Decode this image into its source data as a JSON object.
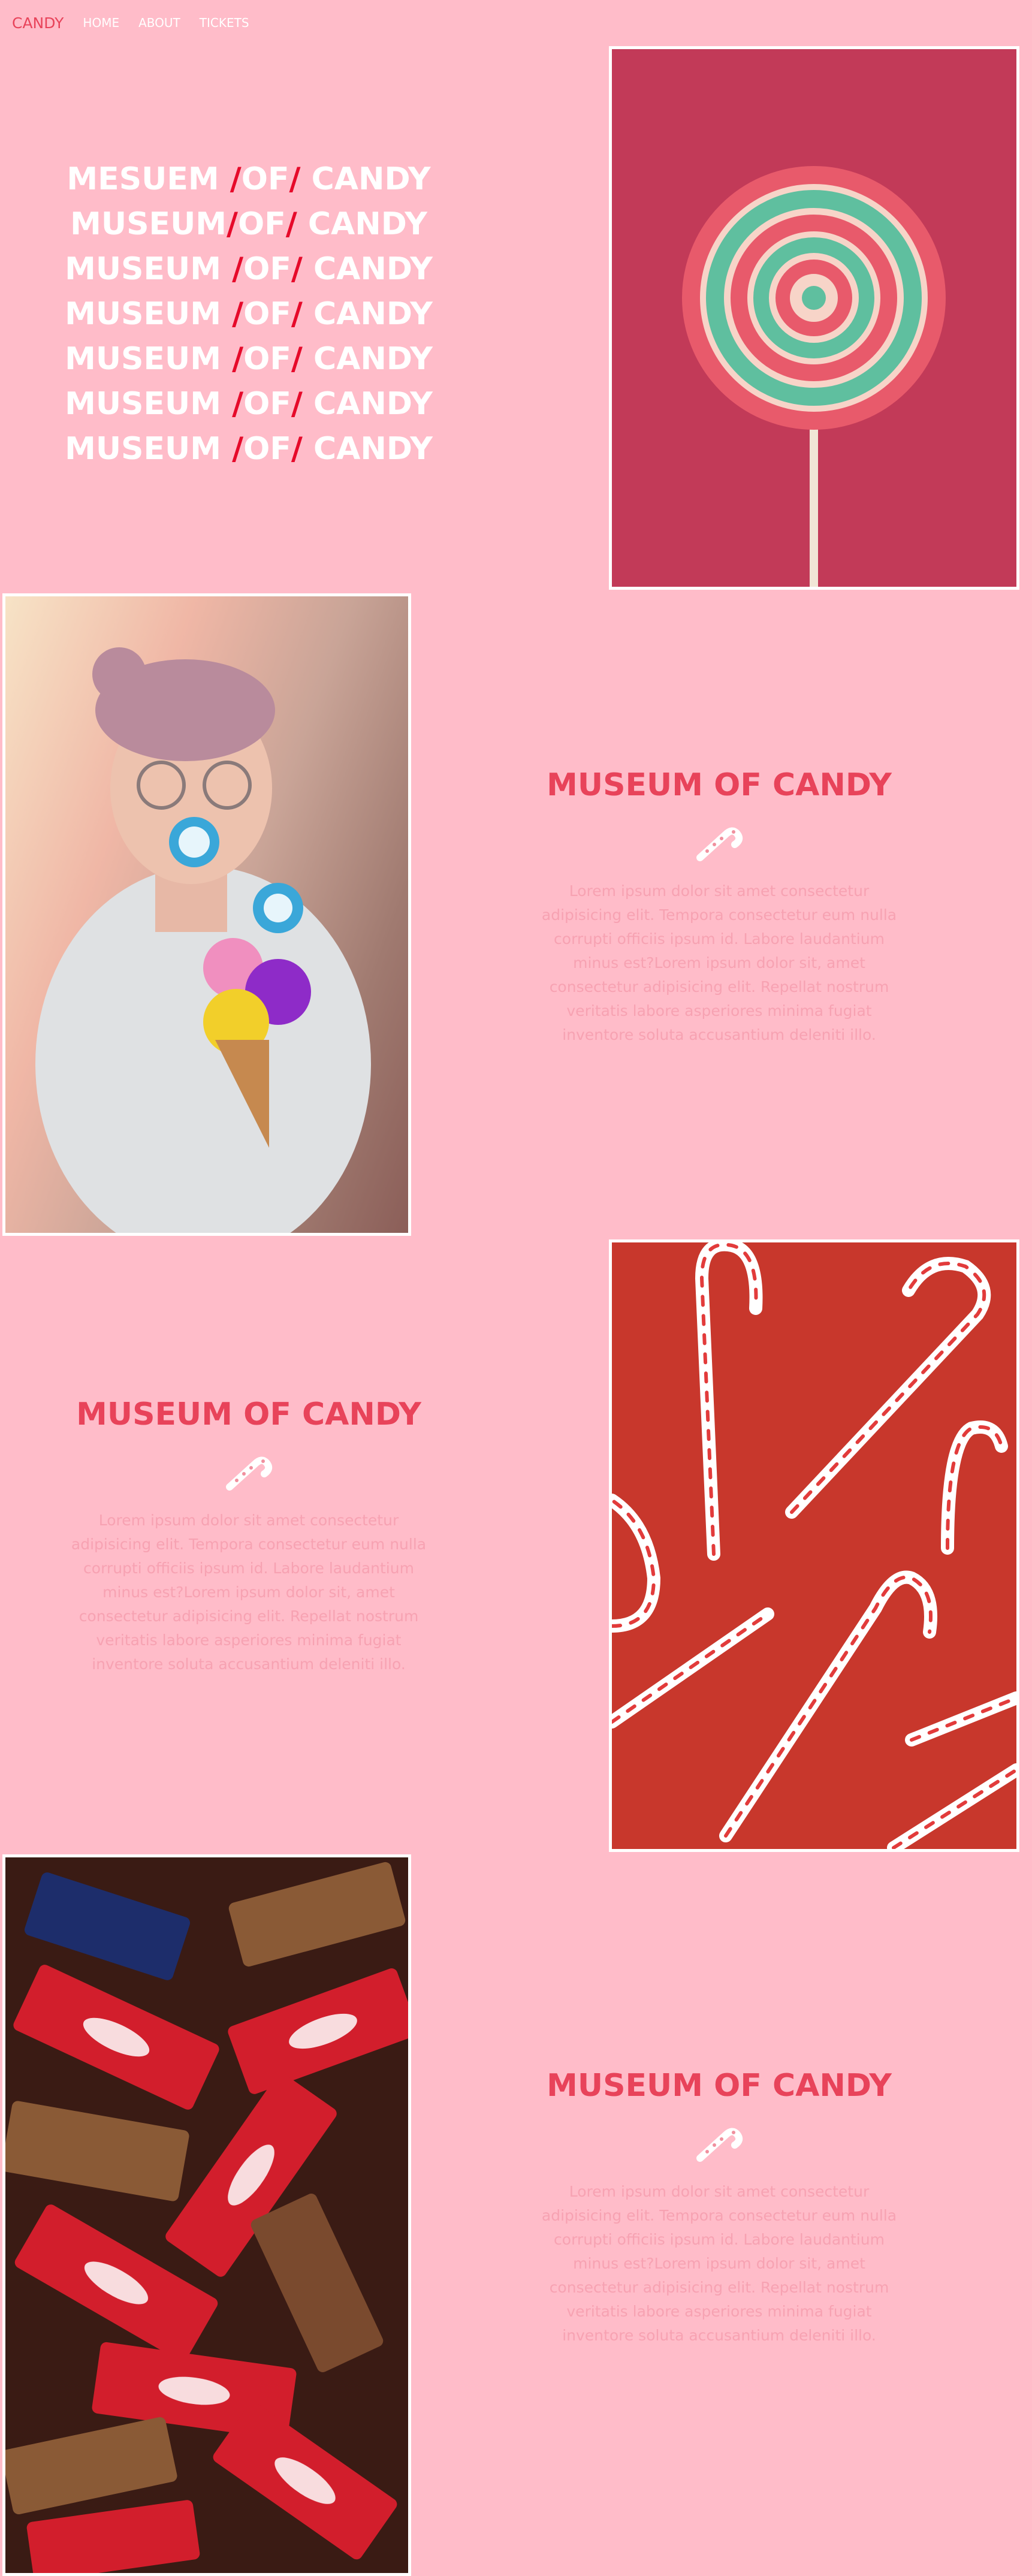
{
  "nav": {
    "brand": "CANDY",
    "links": [
      "HOME",
      "ABOUT",
      "TICKETS"
    ]
  },
  "hero": {
    "lines": [
      {
        "a": "MESUEM ",
        "slash1": "/",
        "b": "OF",
        "slash2": "/",
        "c": " CANDY"
      },
      {
        "a": "MUSEUM",
        "slash1": "/",
        "b": "OF",
        "slash2": "/",
        "c": " CANDY"
      },
      {
        "a": "MUSEUM ",
        "slash1": "/",
        "b": "OF",
        "slash2": "/",
        "c": " CANDY"
      },
      {
        "a": "MUSEUM ",
        "slash1": "/",
        "b": "OF",
        "slash2": "/",
        "c": " CANDY"
      },
      {
        "a": "MUSEUM ",
        "slash1": "/",
        "b": "OF",
        "slash2": "/",
        "c": " CANDY"
      },
      {
        "a": "MUSEUM ",
        "slash1": "/",
        "b": "OF",
        "slash2": "/",
        "c": " CANDY"
      },
      {
        "a": "MUSEUM ",
        "slash1": "/",
        "b": "OF",
        "slash2": "/",
        "c": " CANDY"
      }
    ]
  },
  "sections": [
    {
      "title": "MUSEUM OF CANDY",
      "icon": "candy-cane-icon",
      "body": "Lorem ipsum dolor sit amet consectetur adipisicing elit. Tempora consectetur eum nulla corrupti officiis ipsum id. Labore laudantium minus est?Lorem ipsum dolor sit, amet consectetur adipisicing elit. Repellat nostrum veritatis labore asperiores minima fugiat inventore soluta accusantium deleniti illo."
    },
    {
      "title": "MUSEUM OF CANDY",
      "icon": "candy-cane-icon",
      "body": "Lorem ipsum dolor sit amet consectetur adipisicing elit. Tempora consectetur eum nulla corrupti officiis ipsum id. Labore laudantium minus est?Lorem ipsum dolor sit, amet consectetur adipisicing elit. Repellat nostrum veritatis labore asperiores minima fugiat inventore soluta accusantium deleniti illo."
    },
    {
      "title": "MUSEUM OF CANDY",
      "icon": "candy-cane-icon",
      "body": "Lorem ipsum dolor sit amet consectetur adipisicing elit. Tempora consectetur eum nulla corrupti officiis ipsum id. Labore laudantium minus est?Lorem ipsum dolor sit, amet consectetur adipisicing elit. Repellat nostrum veritatis labore asperiores minima fugiat inventore soluta accusantium deleniti illo."
    }
  ],
  "colors": {
    "background": "#ffbcc9",
    "accent": "#e8435a",
    "slash": "#e60a2a",
    "body_text": "#f7a2b2"
  },
  "images": [
    "lollipop-photo",
    "girl-with-lollipops-photo",
    "candy-canes-photo",
    "chocolate-bars-photo"
  ]
}
